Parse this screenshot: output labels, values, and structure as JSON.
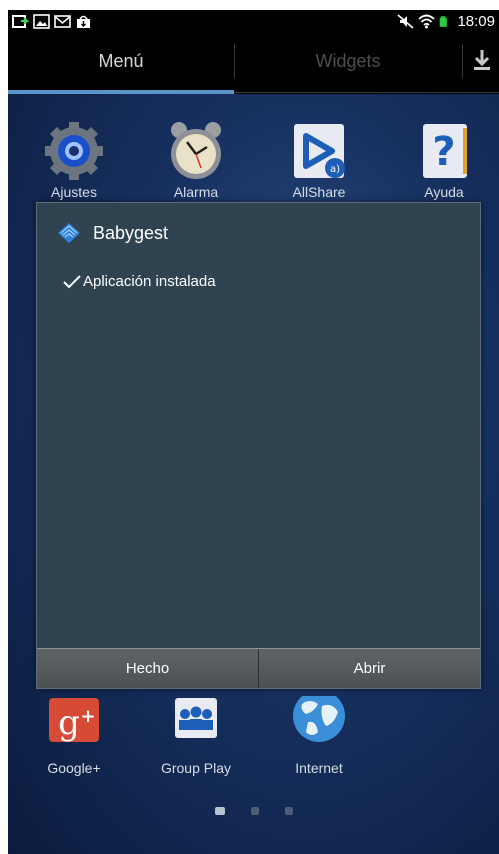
{
  "status_bar": {
    "time": "18:09",
    "left_icons": [
      "usb-icon",
      "image-icon",
      "gmail-icon",
      "store-icon"
    ],
    "right_icons": [
      "mute-icon",
      "wifi-icon",
      "battery-icon"
    ]
  },
  "tabs": [
    {
      "label": "Menú",
      "selected": true
    },
    {
      "label": "Widgets",
      "selected": false
    }
  ],
  "apps_top": [
    {
      "label": "Ajustes",
      "icon": "settings-gear-icon"
    },
    {
      "label": "Alarma",
      "icon": "alarm-clock-icon"
    },
    {
      "label": "AllShare",
      "icon": "allshare-play-icon"
    },
    {
      "label": "Ayuda",
      "icon": "help-icon"
    }
  ],
  "apps_bottom": [
    {
      "label": "Google+",
      "icon": "google-plus-icon"
    },
    {
      "label": "Group Play",
      "icon": "group-play-icon"
    },
    {
      "label": "Internet",
      "icon": "globe-icon"
    }
  ],
  "dialog": {
    "app_name": "Babygest",
    "message": "Aplicación instalada",
    "done_label": "Hecho",
    "open_label": "Abrir"
  },
  "page_indicator": {
    "pages": 3,
    "current": 1
  },
  "colors": {
    "accent": "#5c93c9",
    "dialog_bg": "#2f4450",
    "battery": "#2ecc40"
  }
}
